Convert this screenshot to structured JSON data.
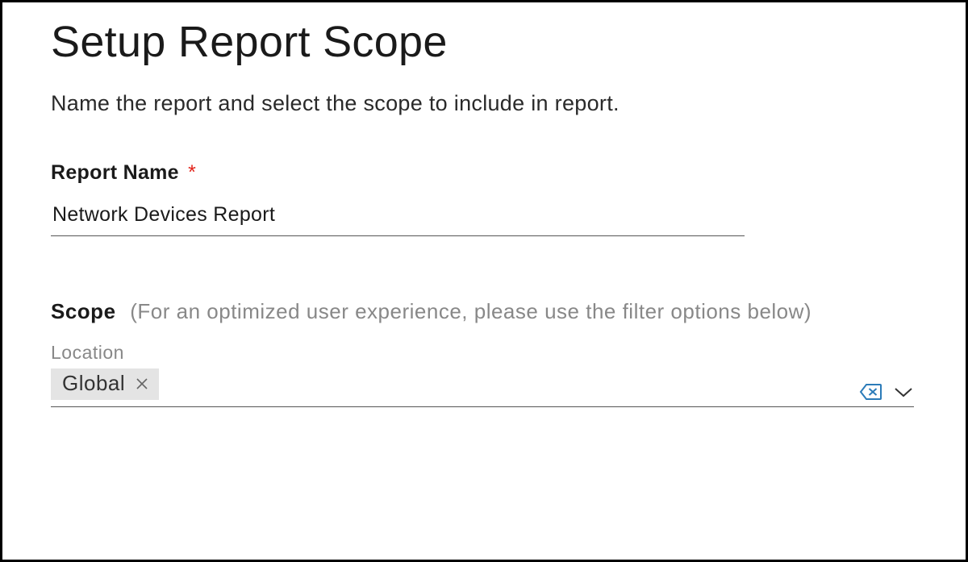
{
  "title": "Setup Report Scope",
  "subtitle": "Name the report and select the scope to include in report.",
  "reportName": {
    "label": "Report Name",
    "required": "*",
    "value": "Network Devices Report"
  },
  "scope": {
    "label": "Scope",
    "hint": "(For an optimized user experience, please use the filter options below)",
    "locationLabel": "Location",
    "locationChip": "Global"
  }
}
